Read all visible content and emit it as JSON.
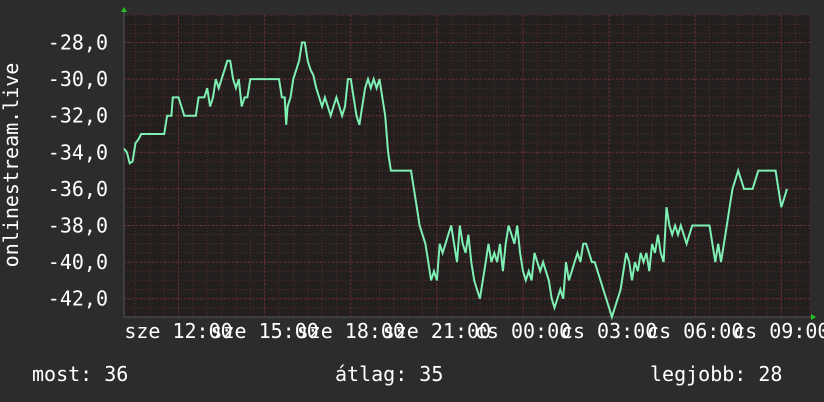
{
  "colors": {
    "background": "#2c2c2c",
    "plot_background": "#231f1f",
    "grid_minor": "#5a2b2b",
    "grid_major": "#6a2e2e",
    "line": "#7ff0b4",
    "axis_arrow": "#22c322",
    "text": "#ffffff"
  },
  "chart_data": {
    "type": "line",
    "ylabel": "onlinestream.live",
    "ylim": [
      -43,
      -26.5
    ],
    "yticks": [
      -28,
      -30,
      -32,
      -34,
      -36,
      -38,
      -40,
      -42
    ],
    "ytick_labels": [
      "-28,0",
      "-30,0",
      "-32,0",
      "-34,0",
      "-36,0",
      "-38,0",
      "-40,0",
      "-42,0"
    ],
    "xlim": [
      10.1,
      34.0
    ],
    "xticks": [
      12,
      15,
      18,
      21,
      24,
      27,
      30,
      33
    ],
    "xtick_labels": [
      "sze 12:00",
      "sze 15:00",
      "sze 18:00",
      "sze 21:00",
      "cs 00:00",
      "cs 03:00",
      "cs 06:00",
      "cs 09:00"
    ],
    "grid": true,
    "series": [
      {
        "values": [
          [
            10.1,
            -33.8
          ],
          [
            10.2,
            -34.0
          ],
          [
            10.3,
            -34.6
          ],
          [
            10.4,
            -34.5
          ],
          [
            10.5,
            -33.5
          ],
          [
            10.6,
            -33.3
          ],
          [
            10.7,
            -33.0
          ],
          [
            11.0,
            -33.0
          ],
          [
            11.5,
            -33.0
          ],
          [
            11.6,
            -32.0
          ],
          [
            11.75,
            -32.0
          ],
          [
            11.8,
            -31.0
          ],
          [
            12.0,
            -31.0
          ],
          [
            12.1,
            -31.5
          ],
          [
            12.2,
            -32.0
          ],
          [
            12.6,
            -32.0
          ],
          [
            12.7,
            -31.0
          ],
          [
            12.9,
            -31.0
          ],
          [
            13.0,
            -30.5
          ],
          [
            13.1,
            -31.5
          ],
          [
            13.2,
            -31.0
          ],
          [
            13.3,
            -30.0
          ],
          [
            13.4,
            -30.5
          ],
          [
            13.5,
            -30.0
          ],
          [
            13.6,
            -29.5
          ],
          [
            13.7,
            -29.0
          ],
          [
            13.8,
            -29.0
          ],
          [
            13.9,
            -30.0
          ],
          [
            14.0,
            -30.5
          ],
          [
            14.1,
            -30.0
          ],
          [
            14.2,
            -31.5
          ],
          [
            14.3,
            -31.0
          ],
          [
            14.4,
            -31.0
          ],
          [
            14.5,
            -30.0
          ],
          [
            15.0,
            -30.0
          ],
          [
            15.5,
            -30.0
          ],
          [
            15.6,
            -31.0
          ],
          [
            15.7,
            -31.0
          ],
          [
            15.75,
            -32.5
          ],
          [
            15.8,
            -31.5
          ],
          [
            15.9,
            -31.0
          ],
          [
            16.0,
            -30.0
          ],
          [
            16.1,
            -29.5
          ],
          [
            16.2,
            -29.0
          ],
          [
            16.3,
            -28.0
          ],
          [
            16.4,
            -28.0
          ],
          [
            16.5,
            -29.0
          ],
          [
            16.6,
            -29.5
          ],
          [
            16.7,
            -29.8
          ],
          [
            16.8,
            -30.5
          ],
          [
            16.9,
            -31.0
          ],
          [
            17.0,
            -31.5
          ],
          [
            17.1,
            -31.0
          ],
          [
            17.2,
            -31.5
          ],
          [
            17.3,
            -32.0
          ],
          [
            17.4,
            -31.5
          ],
          [
            17.5,
            -31.0
          ],
          [
            17.6,
            -31.5
          ],
          [
            17.7,
            -32.0
          ],
          [
            17.8,
            -31.5
          ],
          [
            17.9,
            -30.0
          ],
          [
            18.0,
            -30.0
          ],
          [
            18.1,
            -31.0
          ],
          [
            18.2,
            -32.0
          ],
          [
            18.3,
            -32.5
          ],
          [
            18.4,
            -31.5
          ],
          [
            18.5,
            -30.5
          ],
          [
            18.6,
            -30.0
          ],
          [
            18.7,
            -30.5
          ],
          [
            18.8,
            -30.0
          ],
          [
            18.9,
            -30.5
          ],
          [
            19.0,
            -30.0
          ],
          [
            19.1,
            -31.0
          ],
          [
            19.2,
            -32.0
          ],
          [
            19.3,
            -34.0
          ],
          [
            19.4,
            -35.0
          ],
          [
            19.45,
            -35.0
          ],
          [
            20.1,
            -35.0
          ],
          [
            20.2,
            -36.0
          ],
          [
            20.3,
            -37.0
          ],
          [
            20.4,
            -38.0
          ],
          [
            20.5,
            -38.5
          ],
          [
            20.6,
            -39.0
          ],
          [
            20.7,
            -40.0
          ],
          [
            20.8,
            -41.0
          ],
          [
            20.9,
            -40.5
          ],
          [
            21.0,
            -41.0
          ],
          [
            21.1,
            -39.0
          ],
          [
            21.2,
            -39.5
          ],
          [
            21.3,
            -39.0
          ],
          [
            21.4,
            -38.5
          ],
          [
            21.5,
            -38.0
          ],
          [
            21.6,
            -39.0
          ],
          [
            21.7,
            -40.0
          ],
          [
            21.8,
            -38.0
          ],
          [
            21.9,
            -39.0
          ],
          [
            22.0,
            -39.5
          ],
          [
            22.1,
            -38.5
          ],
          [
            22.2,
            -40.0
          ],
          [
            22.3,
            -41.0
          ],
          [
            22.4,
            -41.5
          ],
          [
            22.5,
            -42.0
          ],
          [
            22.6,
            -41.0
          ],
          [
            22.7,
            -40.0
          ],
          [
            22.8,
            -39.0
          ],
          [
            22.9,
            -40.0
          ],
          [
            23.0,
            -39.5
          ],
          [
            23.1,
            -40.0
          ],
          [
            23.2,
            -39.0
          ],
          [
            23.3,
            -40.5
          ],
          [
            23.4,
            -39.0
          ],
          [
            23.5,
            -38.0
          ],
          [
            23.6,
            -38.5
          ],
          [
            23.7,
            -39.0
          ],
          [
            23.8,
            -38.0
          ],
          [
            23.9,
            -39.5
          ],
          [
            24.0,
            -40.5
          ],
          [
            24.1,
            -41.0
          ],
          [
            24.2,
            -40.5
          ],
          [
            24.3,
            -41.0
          ],
          [
            24.4,
            -39.5
          ],
          [
            24.5,
            -40.0
          ],
          [
            24.6,
            -40.5
          ],
          [
            24.7,
            -40.0
          ],
          [
            24.8,
            -40.5
          ],
          [
            24.9,
            -41.0
          ],
          [
            25.0,
            -42.0
          ],
          [
            25.1,
            -42.5
          ],
          [
            25.2,
            -42.0
          ],
          [
            25.3,
            -41.5
          ],
          [
            25.4,
            -42.0
          ],
          [
            25.5,
            -40.0
          ],
          [
            25.6,
            -41.0
          ],
          [
            25.7,
            -40.5
          ],
          [
            25.8,
            -40.0
          ],
          [
            25.9,
            -39.5
          ],
          [
            26.0,
            -40.0
          ],
          [
            26.1,
            -39.0
          ],
          [
            26.2,
            -39.0
          ],
          [
            26.3,
            -39.5
          ],
          [
            26.4,
            -40.0
          ],
          [
            26.5,
            -40.0
          ],
          [
            26.6,
            -40.5
          ],
          [
            26.7,
            -41.0
          ],
          [
            26.8,
            -41.5
          ],
          [
            26.9,
            -42.0
          ],
          [
            27.0,
            -42.5
          ],
          [
            27.1,
            -43.0
          ],
          [
            27.2,
            -42.5
          ],
          [
            27.3,
            -42.0
          ],
          [
            27.4,
            -41.5
          ],
          [
            27.5,
            -40.5
          ],
          [
            27.6,
            -39.5
          ],
          [
            27.7,
            -40.0
          ],
          [
            27.8,
            -41.0
          ],
          [
            27.9,
            -40.0
          ],
          [
            28.0,
            -40.5
          ],
          [
            28.1,
            -39.5
          ],
          [
            28.2,
            -40.0
          ],
          [
            28.3,
            -39.5
          ],
          [
            28.4,
            -40.5
          ],
          [
            28.5,
            -39.0
          ],
          [
            28.6,
            -39.5
          ],
          [
            28.7,
            -38.5
          ],
          [
            28.8,
            -39.5
          ],
          [
            28.9,
            -40.0
          ],
          [
            29.0,
            -37.0
          ],
          [
            29.1,
            -38.0
          ],
          [
            29.2,
            -38.5
          ],
          [
            29.3,
            -38.0
          ],
          [
            29.4,
            -38.5
          ],
          [
            29.5,
            -38.0
          ],
          [
            29.6,
            -38.5
          ],
          [
            29.7,
            -39.0
          ],
          [
            29.8,
            -38.5
          ],
          [
            29.9,
            -38.0
          ],
          [
            30.0,
            -38.0
          ],
          [
            30.5,
            -38.0
          ],
          [
            30.6,
            -39.0
          ],
          [
            30.7,
            -40.0
          ],
          [
            30.8,
            -39.0
          ],
          [
            30.9,
            -40.0
          ],
          [
            31.0,
            -39.0
          ],
          [
            31.1,
            -38.0
          ],
          [
            31.2,
            -37.0
          ],
          [
            31.3,
            -36.0
          ],
          [
            31.4,
            -35.5
          ],
          [
            31.5,
            -35.0
          ],
          [
            31.6,
            -35.5
          ],
          [
            31.7,
            -36.0
          ],
          [
            32.0,
            -36.0
          ],
          [
            32.1,
            -35.5
          ],
          [
            32.2,
            -35.0
          ],
          [
            32.6,
            -35.0
          ],
          [
            32.8,
            -35.0
          ],
          [
            32.9,
            -36.0
          ],
          [
            33.0,
            -37.0
          ],
          [
            33.1,
            -36.5
          ],
          [
            33.2,
            -36.0
          ]
        ]
      }
    ]
  },
  "footer": {
    "now": "most: 36",
    "avg": "átlag: 35",
    "best": "legjobb: 28"
  }
}
